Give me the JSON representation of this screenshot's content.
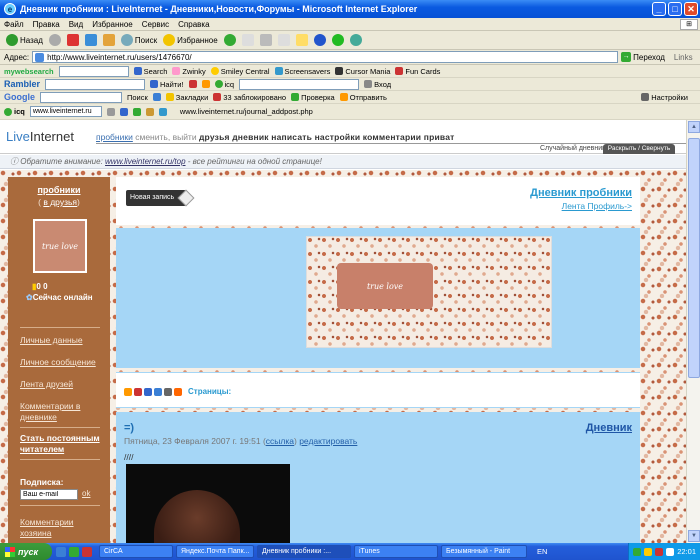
{
  "window": {
    "title": "Дневник пробники : LiveInternet - Дневники,Новости,Форумы - Microsoft Internet Explorer",
    "controls": {
      "minimize": "_",
      "maximize": "□",
      "close": "✕"
    }
  },
  "menu": [
    "Файл",
    "Правка",
    "Вид",
    "Избранное",
    "Сервис",
    "Справка"
  ],
  "toolbar": {
    "back": "Назад",
    "search": "Поиск",
    "favorites": "Избранное"
  },
  "address": {
    "label": "Адрес:",
    "url": "http://www.liveinternet.ru/users/1476670/",
    "go": "Переход",
    "links": "Links"
  },
  "webbar": {
    "brand": "mywebsearch",
    "search_btn": "Search",
    "items": [
      "Zwinky",
      "Smiley Central",
      "Screensavers",
      "Cursor Mania",
      "Fun Cards"
    ]
  },
  "rambler": {
    "brand": "Rambler",
    "find": "Найти!",
    "icq": "icq",
    "login": "Вход"
  },
  "google": {
    "brand": "Google",
    "search_btn": "Поиск",
    "bookmarks": "Закладки",
    "blocked": "33 заблокировано",
    "check": "Проверка",
    "send": "Отправить",
    "settings": "Настройки"
  },
  "icqbar": {
    "brand": "icq",
    "field": "www.liveinternet.ru",
    "url": "www.liveinternet.ru/journal_addpost.php"
  },
  "liheader": {
    "logo_a": "Live",
    "logo_b": "Internet",
    "user": "пробники",
    "change": "сменить",
    "exit": "выйти",
    "menu": "друзья дневник написать настройки комментарии приват",
    "random": "Случайный дневник //",
    "tab": "Раскрыть / Свернуть"
  },
  "notice": {
    "prefix": "Обратите внимание:",
    "link": "www.liveinternet.ru/top",
    "suffix": "- все рейтинги на одной странице!"
  },
  "sidebar": {
    "name": "пробники",
    "friends_open": "( ",
    "friends_link": "в друзья",
    "friends_close": ")",
    "avatar_text": "true love",
    "stats": "0   0",
    "online": "Сейчас онлайн",
    "links": [
      "Личные данные",
      "Личное сообщение",
      "Лента друзей",
      "Комментарии в дневнике"
    ],
    "follow": "Стать постоянным читателем",
    "subscribe": "Подписка:",
    "email_placeholder": "Ваш e-mail",
    "ok": "ok",
    "comments": "Комментарии хозяина"
  },
  "main": {
    "new_post": "Новая запись",
    "diary_title": "Дневник пробники",
    "profile": "Лента Профиль->",
    "banner_text": "true love",
    "pages": "Страницы:"
  },
  "post": {
    "title": "=)",
    "diary_link": "Дневник",
    "date": "Пятница, 23 Февраля 2007 г. 19:51 (",
    "ref": "ссылка",
    "edit": "редактировать",
    "body": "////"
  },
  "taskbar": {
    "start": "пуск",
    "tasks": [
      "CirCA",
      "Яндекс.Почта Папк...",
      "Дневник пробники :...",
      "iTunes",
      "Безымянный - Paint"
    ],
    "lang": "EN",
    "clock": "22:01"
  },
  "colors": {
    "accent": "#2a9ad0",
    "sidebar": "#a96a3c",
    "panel": "#a5d6f6"
  }
}
